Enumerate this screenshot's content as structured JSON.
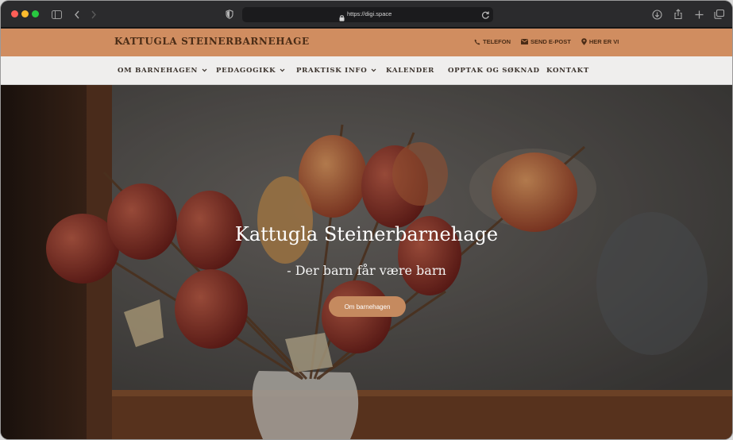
{
  "browser": {
    "url": "https://digi.space",
    "icons": [
      "sidebar-icon",
      "back-icon",
      "forward-icon",
      "shield-icon",
      "lock-icon",
      "reload-icon",
      "download-icon",
      "share-icon",
      "new-tab-icon",
      "tabs-icon"
    ]
  },
  "site": {
    "title": "KATTUGLA STEINERBARNEHAGE",
    "colors": {
      "topbar": "#d08d60",
      "nav": "#efeeed",
      "button": "#c58a5f"
    }
  },
  "toplinks": [
    {
      "label": "TELEFON",
      "icon": "phone-icon"
    },
    {
      "label": "SEND E-POST",
      "icon": "envelope-icon"
    },
    {
      "label": "HER ER VI",
      "icon": "map-pin-icon"
    }
  ],
  "nav": [
    {
      "label": "OM BARNEHAGEN",
      "dropdown": true
    },
    {
      "label": "PEDAGOGIKK",
      "dropdown": true
    },
    {
      "label": "PRAKTISK INFO",
      "dropdown": true
    },
    {
      "label": "KALENDER",
      "dropdown": false
    },
    {
      "label": "OPPTAK OG SØKNAD",
      "dropdown": false
    },
    {
      "label": "KONTAKT",
      "dropdown": false
    }
  ],
  "hero": {
    "title": "Kattugla Steinerbarnehage",
    "subtitle": "- Der barn får være barn",
    "button_label": "Om barnehagen"
  }
}
